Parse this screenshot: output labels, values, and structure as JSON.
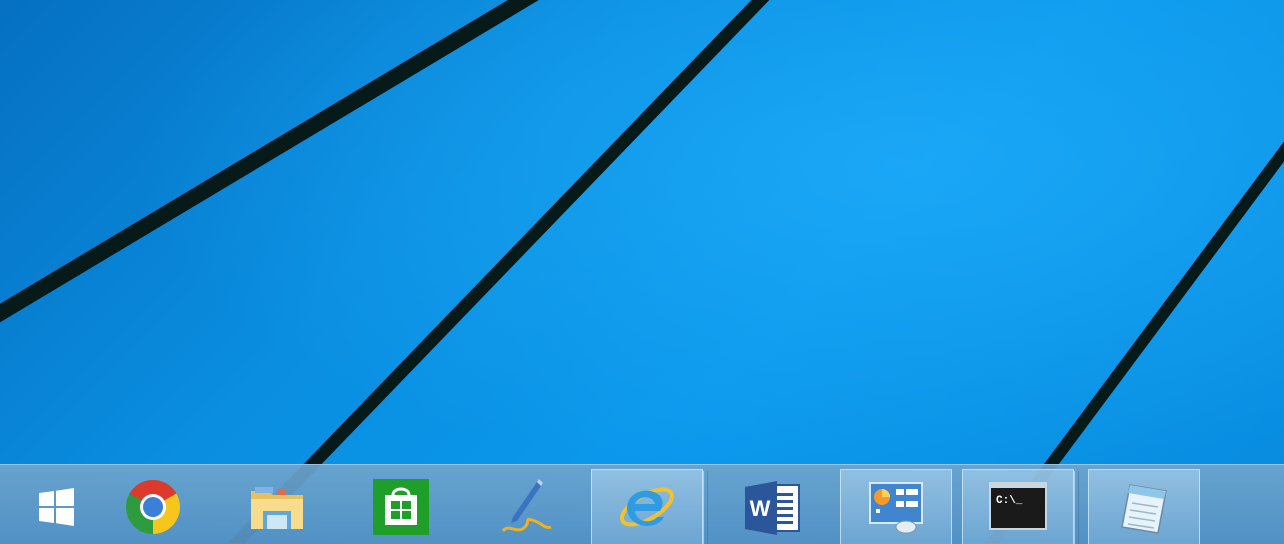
{
  "taskbar": {
    "items": [
      {
        "name": "start",
        "icon": "windows-logo-icon",
        "active": false
      },
      {
        "name": "chrome",
        "icon": "chrome-icon",
        "active": false
      },
      {
        "name": "file-explorer",
        "icon": "file-explorer-icon",
        "active": false
      },
      {
        "name": "store",
        "icon": "store-icon",
        "active": false
      },
      {
        "name": "pen",
        "icon": "pen-icon",
        "active": false
      },
      {
        "name": "internet-explorer",
        "icon": "internet-explorer-icon",
        "active": true
      },
      {
        "name": "word",
        "icon": "word-icon",
        "active": false
      },
      {
        "name": "control-panel",
        "icon": "control-panel-icon",
        "active": true
      },
      {
        "name": "command-prompt",
        "icon": "command-prompt-icon",
        "active": true
      },
      {
        "name": "notepad",
        "icon": "notepad-icon",
        "active": true
      }
    ],
    "word_letter": "W",
    "cmd_text": "C:\\_"
  },
  "colors": {
    "desktop": "#0a8ee0",
    "taskbar": "#5d97c6",
    "store_green": "#1f9e2a",
    "word_blue": "#2b579a"
  }
}
